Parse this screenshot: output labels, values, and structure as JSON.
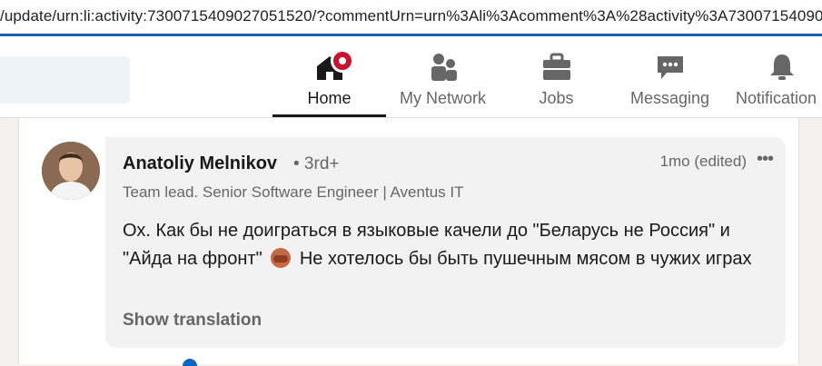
{
  "browser": {
    "url": "/update/urn:li:activity:7300715409027051520/?commentUrn=urn%3Ali%3Acomment%3A%28activity%3A73007154090"
  },
  "nav": {
    "items": [
      {
        "label": "Home",
        "icon": "home-icon",
        "active": true
      },
      {
        "label": "My Network",
        "icon": "people-icon"
      },
      {
        "label": "Jobs",
        "icon": "briefcase-icon"
      },
      {
        "label": "Messaging",
        "icon": "chat-icon"
      },
      {
        "label": "Notification",
        "icon": "bell-icon"
      }
    ]
  },
  "comment": {
    "author": "Anatoliy Melnikov",
    "degree": "• 3rd+",
    "headline": "Team lead. Senior Software Engineer | Aventus IT",
    "time": "1mo (edited)",
    "more": "•••",
    "text_1": "Ох. Как бы не доиграться в языковые качели до \"Беларусь не Россия\" и \"Айда на фронт\"",
    "text_2": "Не хотелось бы быть пушечным мясом в чужих играх",
    "translate": "Show translation"
  },
  "colors": {
    "accent": "#0a66c2",
    "badge": "#cb112d",
    "url_underline": "#1a5fb4"
  }
}
